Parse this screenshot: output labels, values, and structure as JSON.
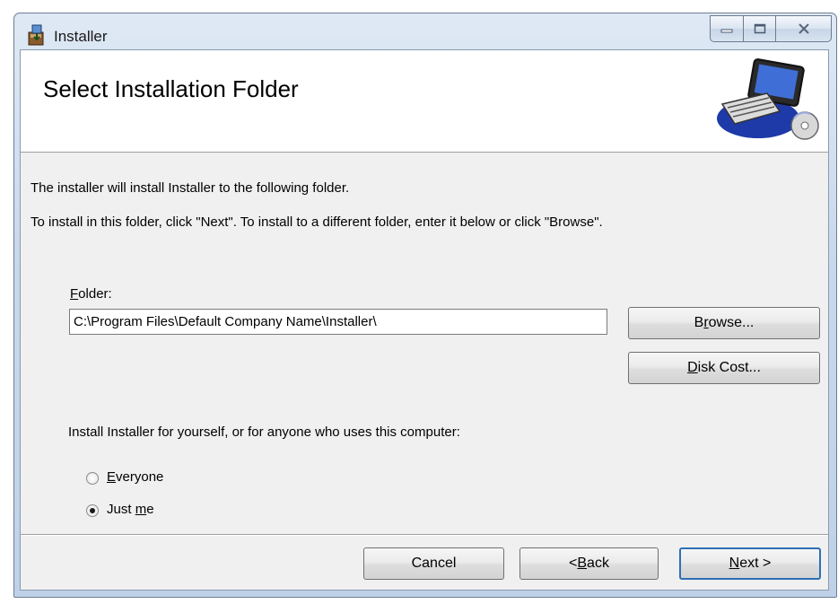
{
  "window": {
    "title": "Installer",
    "icon": "installer-app-icon",
    "caption": {
      "minimize_icon": "minimize-icon",
      "maximize_icon": "maximize-icon",
      "close_icon": "close-icon"
    }
  },
  "banner": {
    "title": "Select Installation Folder",
    "art_icon": "computer-cd-icon"
  },
  "body": {
    "intro_line": "The installer will install Installer to the following folder.",
    "instruction_line": "To install in this folder, click \"Next\". To install to a different folder, enter it below or click \"Browse\"."
  },
  "folder": {
    "label": {
      "mnemonic": "F",
      "rest": "older:"
    },
    "value": "C:\\Program Files\\Default Company Name\\Installer\\"
  },
  "buttons": {
    "browse": {
      "before": "B",
      "mnemonic": "r",
      "after": "owse..."
    },
    "disk_cost": {
      "mnemonic": "D",
      "after": "isk Cost..."
    },
    "cancel": "Cancel",
    "back": {
      "before": "< ",
      "mnemonic": "B",
      "after": "ack"
    },
    "next": {
      "mnemonic": "N",
      "after": "ext >"
    }
  },
  "install_for": {
    "prompt": "Install Installer for yourself, or for anyone who uses this computer:",
    "options": [
      {
        "mnemonic": "E",
        "rest": "veryone",
        "selected": false
      },
      {
        "before": "Just ",
        "mnemonic": "m",
        "after": "e",
        "selected": true
      }
    ]
  },
  "colors": {
    "default_button_border": "#2e6fb5",
    "client_bg": "#f0f0f0",
    "banner_bg": "#ffffff"
  }
}
